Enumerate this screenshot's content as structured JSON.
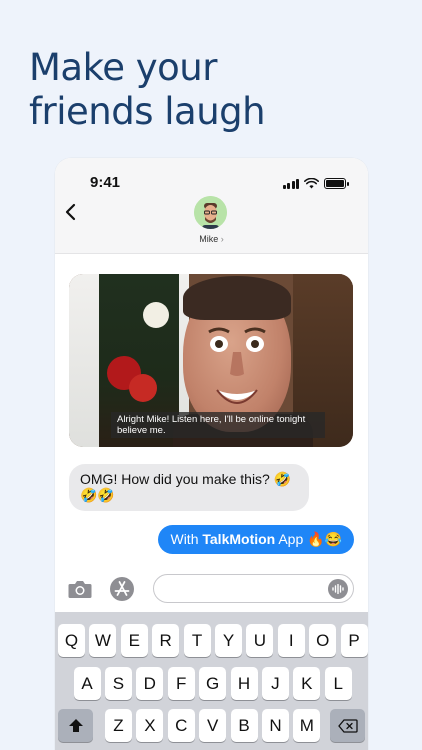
{
  "headline": {
    "line1": "Make your",
    "line2": "friends laugh"
  },
  "status": {
    "time": "9:41"
  },
  "conversation": {
    "contact_name": "Mike",
    "contact_chevron": "›",
    "gif_subtitle": "Alright Mike! Listen here, I'll be online tonight believe me.",
    "incoming": "OMG! How did you make this? 🤣🤣🤣",
    "outgoing_prefix": "With ",
    "outgoing_bold": "TalkMotion",
    "outgoing_suffix": " App 🔥😂"
  },
  "compose": {
    "placeholder": "",
    "value": ""
  },
  "keyboard": {
    "row1": [
      "Q",
      "W",
      "E",
      "R",
      "T",
      "Y",
      "U",
      "I",
      "O",
      "P"
    ],
    "row2": [
      "A",
      "S",
      "D",
      "F",
      "G",
      "H",
      "J",
      "K",
      "L"
    ],
    "row3": [
      "Z",
      "X",
      "C",
      "V",
      "B",
      "N",
      "M"
    ]
  },
  "icons": {
    "back": "chevron-left-icon",
    "camera": "camera-icon",
    "apps": "app-store-icon",
    "audio": "waveform-icon",
    "shift": "shift-icon",
    "delete": "delete-icon"
  },
  "colors": {
    "headline": "#1b3f6c",
    "outgoing_bubble": "#1f86f7",
    "incoming_bubble": "#e9e9eb",
    "background": "#eef3fb"
  }
}
